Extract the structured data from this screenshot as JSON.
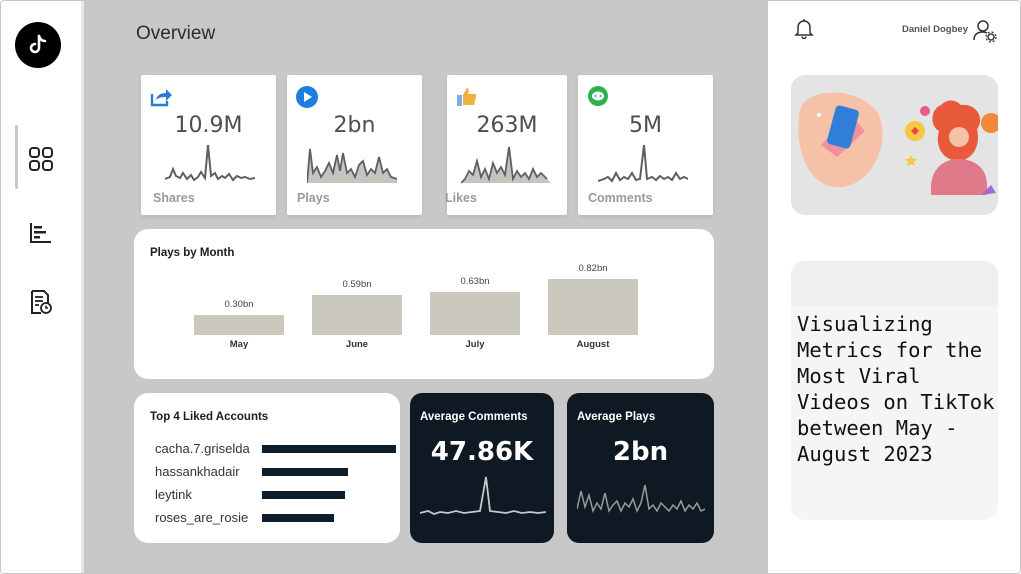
{
  "header": {
    "title": "Overview"
  },
  "user": {
    "name": "Daniel Dogbey"
  },
  "nav": {
    "items": [
      "dashboard-icon",
      "bar-chart-icon",
      "report-icon"
    ]
  },
  "kpis": [
    {
      "icon": "share-icon",
      "value": "10.9M",
      "label": "Shares",
      "color": "#2b7bd6"
    },
    {
      "icon": "play-icon",
      "value": "2bn",
      "label": "Plays",
      "color": "#1a7fe0"
    },
    {
      "icon": "thumbs-up-icon",
      "value": "263M",
      "label": "Likes",
      "color": "#f0b040"
    },
    {
      "icon": "comment-icon",
      "value": "5M",
      "label": "Comments",
      "color": "#2bb34b"
    }
  ],
  "plays_by_month": {
    "title": "Plays by Month"
  },
  "chart_data": {
    "type": "bar",
    "title": "Plays by Month",
    "categories": [
      "May",
      "June",
      "July",
      "August"
    ],
    "values": [
      0.3,
      0.59,
      0.63,
      0.82
    ],
    "value_labels": [
      "0.30bn",
      "0.59bn",
      "0.63bn",
      "0.82bn"
    ],
    "ylim": [
      0,
      0.82
    ],
    "grid": false,
    "bar_color": "#cbc8bd"
  },
  "top_accounts": {
    "title": "Top 4 Liked Accounts",
    "accounts": [
      {
        "name": "cacha.7.griselda",
        "share": 1.0
      },
      {
        "name": "hassankhadair",
        "share": 0.64
      },
      {
        "name": "leytink",
        "share": 0.62
      },
      {
        "name": "roses_are_rosie",
        "share": 0.54
      }
    ]
  },
  "avg_comments": {
    "title": "Average Comments",
    "value": "47.86K"
  },
  "avg_plays": {
    "title": "Average Plays",
    "value": "2bn"
  },
  "info": {
    "text": "Visualizing Metrics for the Most Viral Videos on TikTok between May - August 2023"
  },
  "colors": {
    "main_bg": "#c9c8c9",
    "dark_card": "#0f1923",
    "bar": "#cbc8bd",
    "accent_bar": "#0f1e2c"
  }
}
